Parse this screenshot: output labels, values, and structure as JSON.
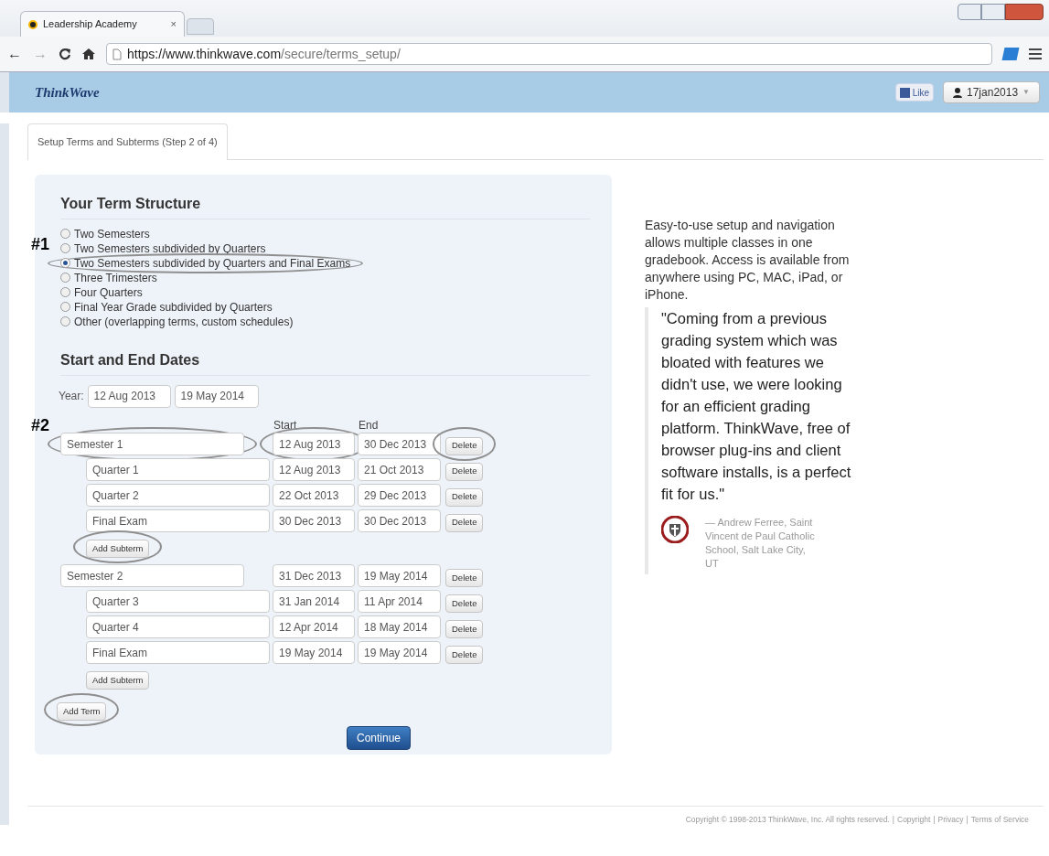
{
  "browser": {
    "tab_title": "Leadership Academy",
    "tab_close": "×",
    "url_host": "https://www.thinkwave.com",
    "url_path": "/secure/terms_setup/",
    "back": "←",
    "forward": "→"
  },
  "header": {
    "logo": "ThinkWave",
    "like": "Like",
    "user": "17jan2013",
    "caret": "▼"
  },
  "page_tab": {
    "label": "Setup Terms and Subterms (Step 2 of 4)",
    "selected": true
  },
  "term_structure": {
    "title": "Your Term Structure",
    "marker": "#1",
    "options": [
      {
        "label": "Two Semesters",
        "selected": false,
        "circled": false
      },
      {
        "label": "Two Semesters subdivided by Quarters",
        "selected": false,
        "circled": false
      },
      {
        "label": "Two Semesters subdivided by Quarters and Final Exams",
        "selected": true,
        "circled": true
      },
      {
        "label": "Three Trimesters",
        "selected": false,
        "circled": false
      },
      {
        "label": "Four Quarters",
        "selected": false,
        "circled": false
      },
      {
        "label": "Final Year Grade subdivided by Quarters",
        "selected": false,
        "circled": false
      },
      {
        "label": "Other (overlapping terms, custom schedules)",
        "selected": false,
        "circled": false
      }
    ]
  },
  "dates": {
    "title": "Start and End Dates",
    "year_label": "Year:",
    "year_start": "12 Aug 2013",
    "year_end": "19 May 2014",
    "marker": "#2",
    "start_header": "Start",
    "end_header": "End",
    "terms": [
      {
        "name": "Semester 1",
        "start": "12 Aug 2013",
        "end": "30 Dec 2013",
        "delete": "Delete",
        "circled": true,
        "add_subterm": "Add Subterm",
        "add_circled": true,
        "children": [
          {
            "name": "Quarter 1",
            "start": "12 Aug 2013",
            "end": "21 Oct 2013",
            "delete": "Delete"
          },
          {
            "name": "Quarter 2",
            "start": "22 Oct 2013",
            "end": "29 Dec 2013",
            "delete": "Delete"
          },
          {
            "name": "Final Exam",
            "start": "30 Dec 2013",
            "end": "30 Dec 2013",
            "delete": "Delete"
          }
        ]
      },
      {
        "name": "Semester 2",
        "start": "31 Dec 2013",
        "end": "19 May 2014",
        "delete": "Delete",
        "circled": false,
        "add_subterm": "Add Subterm",
        "add_circled": false,
        "children": [
          {
            "name": "Quarter 3",
            "start": "31 Jan 2014",
            "end": "11 Apr 2014",
            "delete": "Delete"
          },
          {
            "name": "Quarter 4",
            "start": "12 Apr 2014",
            "end": "18 May 2014",
            "delete": "Delete"
          },
          {
            "name": "Final Exam",
            "start": "19 May 2014",
            "end": "19 May 2014",
            "delete": "Delete"
          }
        ]
      }
    ],
    "add_term": "Add Term",
    "add_term_circled": true,
    "continue": "Continue"
  },
  "side": {
    "intro": "Easy-to-use setup and navigation allows multiple classes in one gradebook. Access is available from anywhere using PC, MAC, iPad, or iPhone.",
    "quote": "\"Coming from a previous grading system which was bloated with features we didn't use, we were looking for an efficient grading platform. ThinkWave, free of browser plug-ins and client software installs, is a perfect fit for us.\"",
    "attribution": "— Andrew Ferree, Saint Vincent de Paul Catholic School, Salt Lake City, UT"
  },
  "footer": {
    "notice": "Copyright © 1998-2013 ThinkWave, Inc. All rights reserved.",
    "separators": [
      "|",
      "|",
      "|"
    ],
    "links": [
      "Copyright",
      "Privacy",
      "Terms of Service"
    ]
  }
}
